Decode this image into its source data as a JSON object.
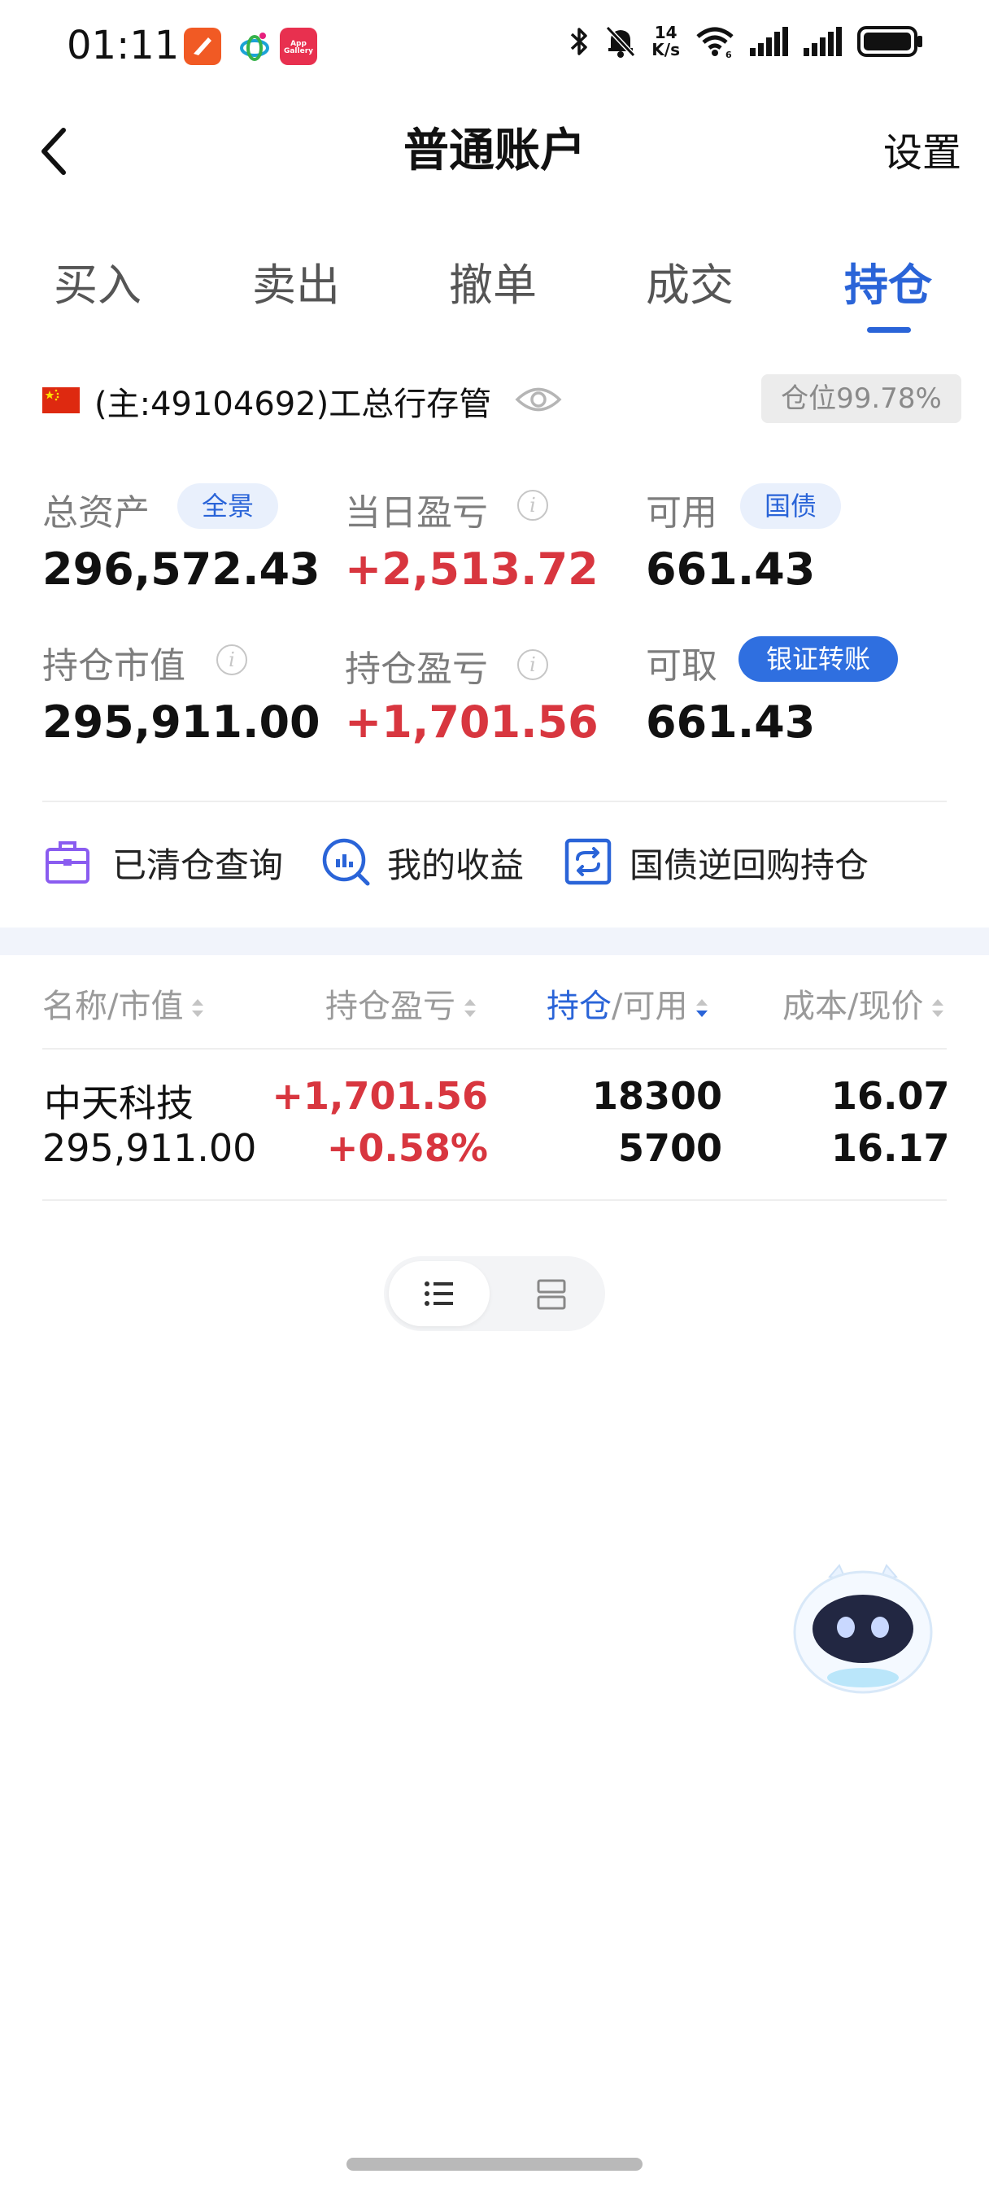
{
  "status_bar": {
    "time": "01:11",
    "app_gallery_text": "App Gallery",
    "net_speed_value": "14",
    "net_speed_unit": "K/s"
  },
  "nav": {
    "back_icon": "chevron-left-icon",
    "title": "普通账户",
    "right": "设置"
  },
  "tabs": [
    "买入",
    "卖出",
    "撤单",
    "成交",
    "持仓"
  ],
  "active_tab": "持仓",
  "account": {
    "label": "(主:49104692)工总行存管",
    "position_badge": "仓位99.78%"
  },
  "stats": {
    "total_assets_label": "总资产",
    "total_assets_tag": "全景",
    "total_assets": "296,572.43",
    "daily_pnl_label": "当日盈亏",
    "daily_pnl": "+2,513.72",
    "available_label": "可用",
    "available_tag": "国债",
    "available": "661.43",
    "market_value_label": "持仓市值",
    "market_value": "295,911.00",
    "position_pnl_label": "持仓盈亏",
    "position_pnl": "+1,701.56",
    "withdrawable_label": "可取",
    "withdrawable_tag": "银证转账",
    "withdrawable": "661.43"
  },
  "quick_links": [
    "已清仓查询",
    "我的收益",
    "国债逆回购持仓"
  ],
  "table": {
    "headers": {
      "name": "名称/市值",
      "pnl": "持仓盈亏",
      "hold_a": "持仓",
      "hold_b": "/可用",
      "cost": "成本/现价"
    },
    "rows": [
      {
        "name": "中天科技",
        "market_value": "295,911.00",
        "pnl": "+1,701.56",
        "pnl_pct": "+0.58%",
        "holding": "18300",
        "available": "5700",
        "cost": "16.077",
        "price": "16.170"
      }
    ]
  },
  "colors": {
    "accent": "#2a64d8",
    "profit_red": "#d8363f",
    "label_gray": "#7d7d7d"
  }
}
